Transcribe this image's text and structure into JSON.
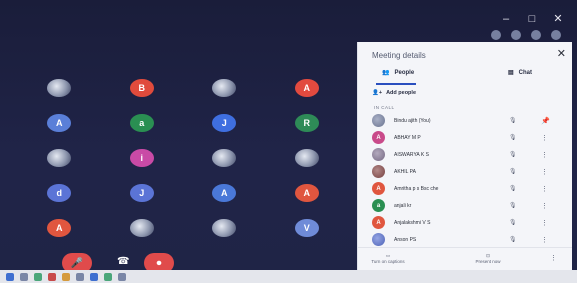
{
  "window": {
    "controls": [
      "–",
      "□",
      "✕"
    ]
  },
  "grid_tiles": [
    {
      "kind": "photo"
    },
    {
      "kind": "letter",
      "letter": "B",
      "color": "#e04b3c"
    },
    {
      "kind": "photo"
    },
    {
      "kind": "letter",
      "letter": "A",
      "color": "#e24a3f"
    },
    {
      "kind": "letter",
      "letter": "A",
      "color": "#5a7fd8"
    },
    {
      "kind": "letter",
      "letter": "a",
      "color": "#2a8f52"
    },
    {
      "kind": "letter",
      "letter": "J",
      "color": "#3f6fe0"
    },
    {
      "kind": "letter",
      "letter": "R",
      "color": "#2e8b57"
    },
    {
      "kind": "photo"
    },
    {
      "kind": "letter",
      "letter": "i",
      "color": "#c94aa6"
    },
    {
      "kind": "photo"
    },
    {
      "kind": "photo"
    },
    {
      "kind": "letter",
      "letter": "d",
      "color": "#5b74d6"
    },
    {
      "kind": "letter",
      "letter": "J",
      "color": "#5b74d6"
    },
    {
      "kind": "letter",
      "letter": "A",
      "color": "#4a78d8"
    },
    {
      "kind": "letter",
      "letter": "A",
      "color": "#e0563f"
    },
    {
      "kind": "letter",
      "letter": "A",
      "color": "#e0563f"
    },
    {
      "kind": "photo"
    },
    {
      "kind": "photo"
    },
    {
      "kind": "letter",
      "letter": "V",
      "color": "#6f8bd8"
    }
  ],
  "panel": {
    "title": "Meeting details",
    "close": "✕",
    "tab_people": "People",
    "tab_chat": "Chat",
    "add_people": "Add people",
    "in_call": "IN CALL",
    "participants": [
      {
        "name": "Bindu ajith (You)",
        "kind": "photo",
        "color": "#7b86a8"
      },
      {
        "name": "ABHAY M P",
        "kind": "letter",
        "letter": "A",
        "color": "#c94a8a"
      },
      {
        "name": "AISWARYA K S",
        "kind": "photo",
        "color": "#8a7b9a"
      },
      {
        "name": "AKHIL PA",
        "kind": "photo",
        "color": "#8a4a4a"
      },
      {
        "name": "Amritha p s Bsc che",
        "kind": "letter",
        "letter": "A",
        "color": "#e0563f"
      },
      {
        "name": "anjali kr",
        "kind": "letter",
        "letter": "a",
        "color": "#2a8f52"
      },
      {
        "name": "Anjalakshmi V S",
        "kind": "letter",
        "letter": "A",
        "color": "#e0563f"
      },
      {
        "name": "Anson PS",
        "kind": "photo",
        "color": "#5b74d6"
      }
    ],
    "footer_left": "Turn on captions",
    "footer_right": "Present now"
  }
}
